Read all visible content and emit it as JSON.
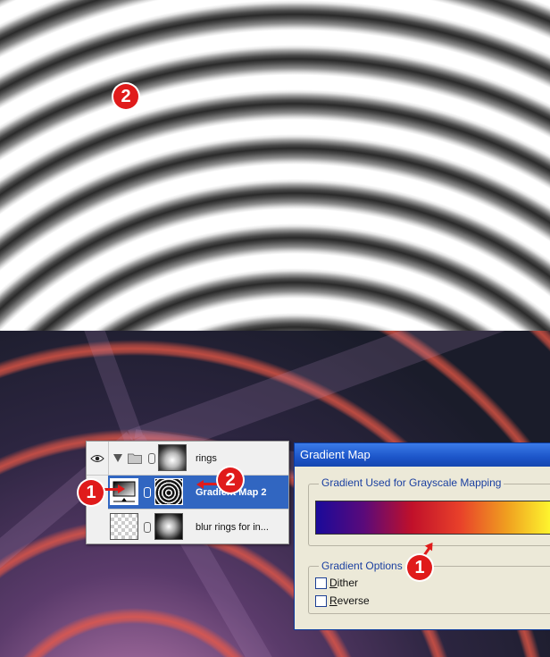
{
  "layers": {
    "group_name": "rings",
    "rows": [
      {
        "name": "rings",
        "kind": "group"
      },
      {
        "name": "Gradient Map 2",
        "kind": "adjustment",
        "selected": true
      },
      {
        "name": "blur rings for in...",
        "kind": "pixel"
      }
    ]
  },
  "dialog": {
    "title": "Gradient Map",
    "group1_label": "Gradient Used for Grayscale Mapping",
    "group2_label": "Gradient Options",
    "dither_label": "Dither",
    "dither_accel": "D",
    "dither_rest": "ither",
    "reverse_label": "Reverse",
    "reverse_accel": "R",
    "reverse_rest": "everse",
    "dither_checked": false,
    "reverse_checked": false,
    "gradient_colors": [
      "#1a0a9a",
      "#5a0a7a",
      "#c0102a",
      "#e8402a",
      "#f0a020",
      "#ffff30"
    ]
  },
  "badges": {
    "b1": "1",
    "b2": "2",
    "b3": "1",
    "b4": "2"
  },
  "colors": {
    "selection": "#3166c1",
    "badge": "#e01b1b"
  }
}
